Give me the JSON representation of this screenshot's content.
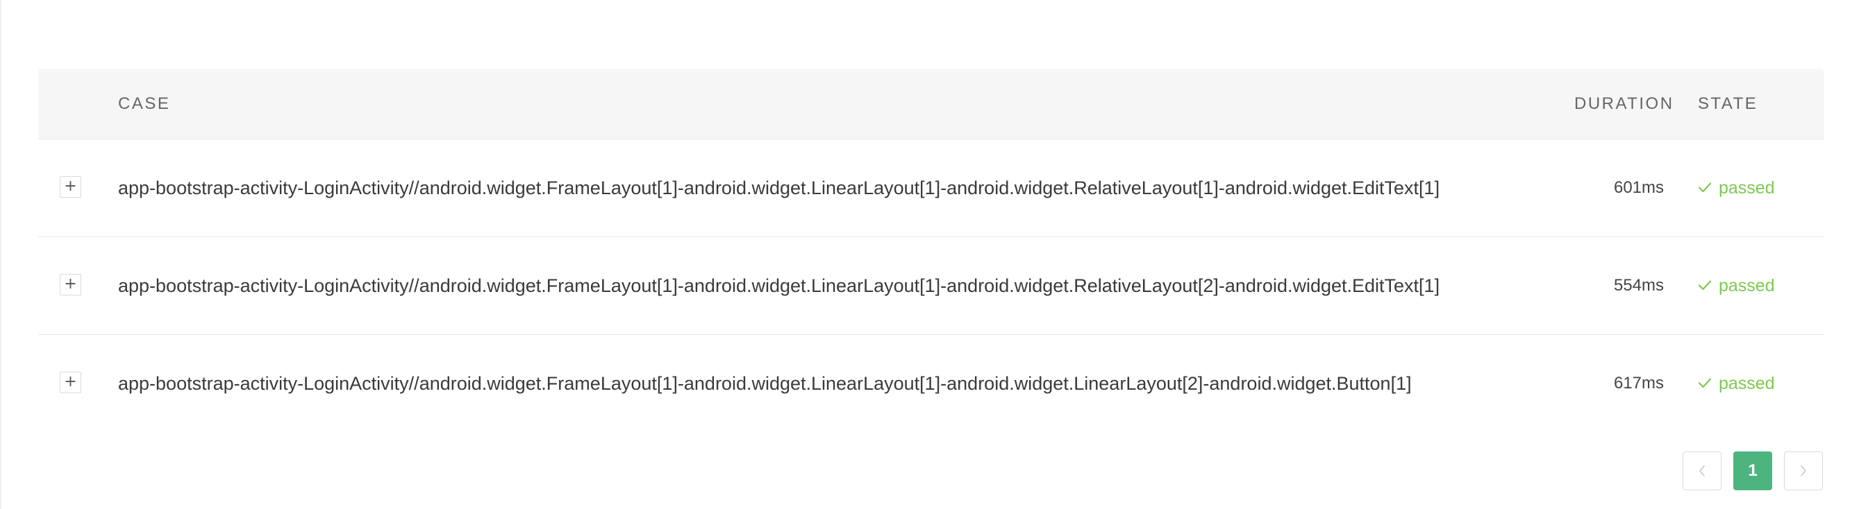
{
  "table": {
    "headers": {
      "case": "CASE",
      "duration": "DURATION",
      "state": "STATE"
    },
    "rows": [
      {
        "expand_label": "+",
        "case": "app-bootstrap-activity-LoginActivity//android.widget.FrameLayout[1]-android.widget.LinearLayout[1]-android.widget.RelativeLayout[1]-android.widget.EditText[1]",
        "duration": "601ms",
        "state": "passed"
      },
      {
        "expand_label": "+",
        "case": "app-bootstrap-activity-LoginActivity//android.widget.FrameLayout[1]-android.widget.LinearLayout[1]-android.widget.RelativeLayout[2]-android.widget.EditText[1]",
        "duration": "554ms",
        "state": "passed"
      },
      {
        "expand_label": "+",
        "case": "app-bootstrap-activity-LoginActivity//android.widget.FrameLayout[1]-android.widget.LinearLayout[1]-android.widget.LinearLayout[2]-android.widget.Button[1]",
        "duration": "617ms",
        "state": "passed"
      }
    ]
  },
  "pagination": {
    "prev_icon": "chevron-left-icon",
    "current_page": "1",
    "next_icon": "chevron-right-icon"
  },
  "colors": {
    "passed": "#7ec850",
    "active_page": "#4cb57f",
    "header_bg": "#f6f6f6"
  }
}
